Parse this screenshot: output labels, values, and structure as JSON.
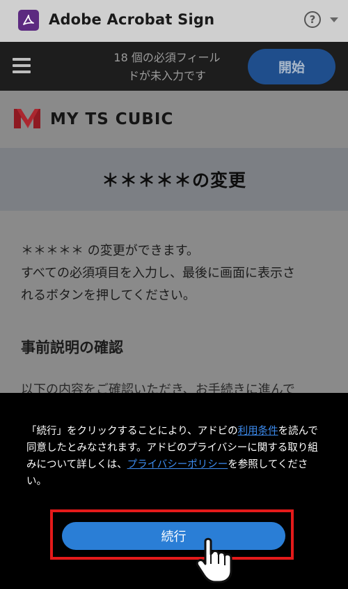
{
  "app": {
    "title": "Adobe Acrobat Sign",
    "help_label": "?"
  },
  "fieldbar": {
    "message_line1": "18 個の必須フィール",
    "message_line2": "ドが未入力です",
    "start_label": "開始"
  },
  "brand": {
    "name": "MY TS CUBIC"
  },
  "page": {
    "title": "＊＊＊＊＊の変更",
    "intro_line1": "＊＊＊＊＊ の変更ができます。",
    "intro_line2": "すべての必須項目を入力し、最後に画面に表示さ",
    "intro_line3": "れるボタンを押してください。",
    "section_title": "事前説明の確認",
    "section_text": "以下の内容をご確認いただき、お手続きに進んで"
  },
  "consent": {
    "text_part1": "「続行」をクリックすることにより、アドビの",
    "terms_link": "利用条件",
    "text_part2": "を読んで同意したとみなされます。アドビのプライバシーに関する取り組みについて詳しくは、",
    "privacy_link": "プライバシーポリシー",
    "text_part3": "を参照してください。",
    "continue_label": "続行"
  },
  "colors": {
    "accent_blue": "#2a7ed6",
    "highlight_red": "#e41a1a",
    "acrobat_purple": "#5c2a80"
  }
}
